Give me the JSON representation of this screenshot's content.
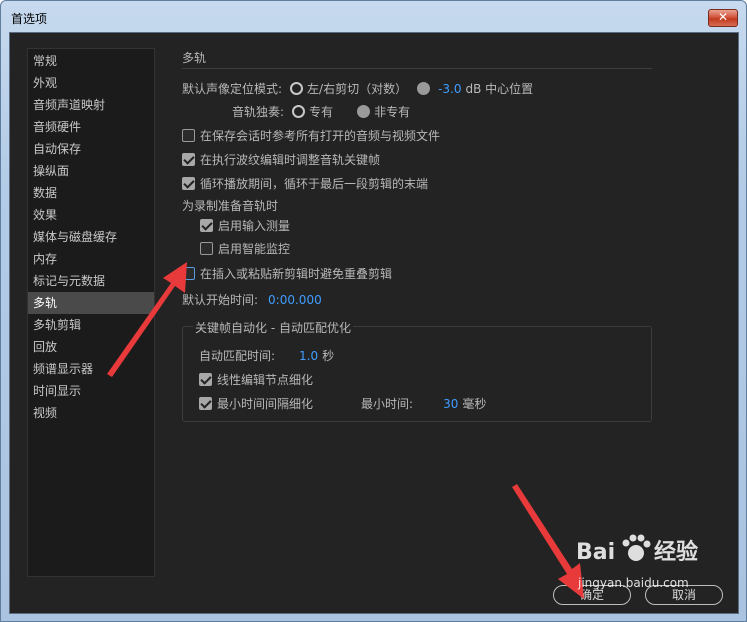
{
  "window": {
    "title": "首选项",
    "close_glyph": "✕"
  },
  "sidebar": {
    "items": [
      {
        "label": "常规",
        "active": false
      },
      {
        "label": "外观",
        "active": false
      },
      {
        "label": "音频声道映射",
        "active": false
      },
      {
        "label": "音频硬件",
        "active": false
      },
      {
        "label": "自动保存",
        "active": false
      },
      {
        "label": "操纵面",
        "active": false
      },
      {
        "label": "数据",
        "active": false
      },
      {
        "label": "效果",
        "active": false
      },
      {
        "label": "媒体与磁盘缓存",
        "active": false
      },
      {
        "label": "内存",
        "active": false
      },
      {
        "label": "标记与元数据",
        "active": false
      },
      {
        "label": "多轨",
        "active": true
      },
      {
        "label": "多轨剪辑",
        "active": false
      },
      {
        "label": "回放",
        "active": false
      },
      {
        "label": "频谱显示器",
        "active": false
      },
      {
        "label": "时间显示",
        "active": false
      },
      {
        "label": "视频",
        "active": false
      }
    ]
  },
  "main": {
    "section_title": "多轨",
    "pan_mode": {
      "label": "默认声像定位模式:",
      "option_lr": "左/右剪切（对数）",
      "option_center_value": "-3.0",
      "option_center_unit": "dB 中心位置"
    },
    "track_solo": {
      "label": "音轨独奏:",
      "option_exclusive": "专有",
      "option_non_exclusive": "非专有"
    },
    "checkbox_reference_files": "在保存会话时参考所有打开的音频与视频文件",
    "checkbox_ripple_keyframes": "在执行波纹编辑时调整音轨关键帧",
    "checkbox_loop_last": "循环播放期间，循环于最后一段剪辑的末端",
    "record_prep_label": "为录制准备音轨时",
    "checkbox_input_meter": "启用输入测量",
    "checkbox_smart_monitor": "启用智能监控",
    "checkbox_avoid_overlap": "在插入或粘贴新剪辑时避免重叠剪辑",
    "default_start_label": "默认开始时间:",
    "default_start_value": "0:00.000",
    "keyframe_group": {
      "title": "关键帧自动化 - 自动匹配优化",
      "auto_match_label": "自动匹配时间:",
      "auto_match_value": "1.0",
      "auto_match_unit": "秒",
      "checkbox_linear": "线性编辑节点细化",
      "checkbox_min_interval": "最小时间间隔细化",
      "min_time_label": "最小时间:",
      "min_time_value": "30",
      "min_time_unit": "毫秒"
    }
  },
  "buttons": {
    "ok": "确定",
    "cancel": "取消"
  },
  "watermark": {
    "brand": "Bai",
    "brand2": "经验",
    "url": "jingyan.baidu.com"
  },
  "colors": {
    "accent_value": "#3f9dff",
    "annotation_arrow": "#e83a3a"
  }
}
